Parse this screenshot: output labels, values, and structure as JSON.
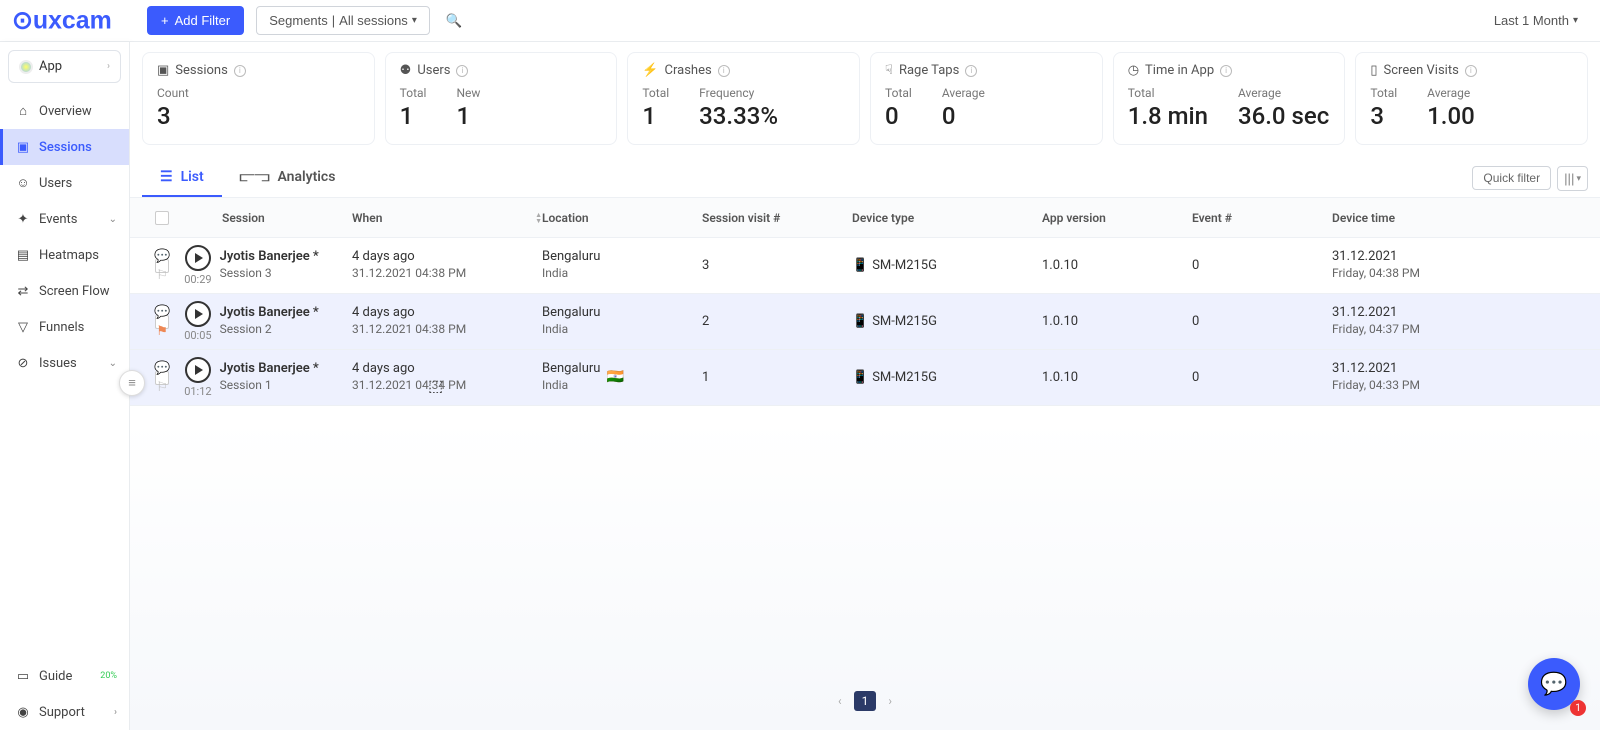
{
  "topbar": {
    "add_filter_label": "Add Filter",
    "segments_label": "Segments",
    "segments_value": "All sessions",
    "date_range_label": "Last 1 Month"
  },
  "sidebar": {
    "app_label": "App",
    "items": [
      {
        "label": "Overview"
      },
      {
        "label": "Sessions"
      },
      {
        "label": "Users"
      },
      {
        "label": "Events"
      },
      {
        "label": "Heatmaps"
      },
      {
        "label": "Screen Flow"
      },
      {
        "label": "Funnels"
      },
      {
        "label": "Issues"
      }
    ],
    "guide_label": "Guide",
    "support_label": "Support"
  },
  "summary": {
    "sessions": {
      "title": "Sessions",
      "count_label": "Count",
      "count_value": "3"
    },
    "users": {
      "title": "Users",
      "total_label": "Total",
      "total_value": "1",
      "new_label": "New",
      "new_value": "1"
    },
    "crashes": {
      "title": "Crashes",
      "total_label": "Total",
      "total_value": "1",
      "freq_label": "Frequency",
      "freq_value": "33.33%"
    },
    "rage": {
      "title": "Rage Taps",
      "total_label": "Total",
      "total_value": "0",
      "avg_label": "Average",
      "avg_value": "0"
    },
    "time": {
      "title": "Time in App",
      "total_label": "Total",
      "total_value": "1.8 min",
      "avg_label": "Average",
      "avg_value": "36.0 sec"
    },
    "screens": {
      "title": "Screen Visits",
      "total_label": "Total",
      "total_value": "3",
      "avg_label": "Average",
      "avg_value": "1.00"
    }
  },
  "tabs": {
    "list_label": "List",
    "analytics_label": "Analytics",
    "quick_filter_label": "Quick filter"
  },
  "table": {
    "columns": {
      "session": "Session",
      "when": "When",
      "location": "Location",
      "visit": "Session visit #",
      "device": "Device type",
      "appver": "App version",
      "event": "Event #",
      "devtime": "Device time"
    },
    "rows": [
      {
        "duration": "00:29",
        "user": "Jyotis Banerjee *",
        "session": "Session 3",
        "when_rel": "4 days ago",
        "when_abs": "31.12.2021 04:38 PM",
        "city": "Bengaluru",
        "country": "India",
        "visit": "3",
        "device": "SM-M215G",
        "appver": "1.0.10",
        "event": "0",
        "devtime_date": "31.12.2021",
        "devtime_time": "Friday, 04:38 PM"
      },
      {
        "duration": "00:05",
        "user": "Jyotis Banerjee *",
        "session": "Session 2",
        "when_rel": "4 days ago",
        "when_abs": "31.12.2021 04:38 PM",
        "city": "Bengaluru",
        "country": "India",
        "visit": "2",
        "device": "SM-M215G",
        "appver": "1.0.10",
        "event": "0",
        "devtime_date": "31.12.2021",
        "devtime_time": "Friday, 04:37 PM"
      },
      {
        "duration": "01:12",
        "user": "Jyotis Banerjee *",
        "session": "Session 1",
        "when_rel": "4 days ago",
        "when_abs": "31.12.2021 04:34 PM",
        "city": "Bengaluru",
        "country": "India",
        "visit": "1",
        "device": "SM-M215G",
        "appver": "1.0.10",
        "event": "0",
        "devtime_date": "31.12.2021",
        "devtime_time": "Friday, 04:33 PM"
      }
    ]
  },
  "pagination": {
    "current": "1"
  },
  "chat": {
    "badge": "1"
  }
}
